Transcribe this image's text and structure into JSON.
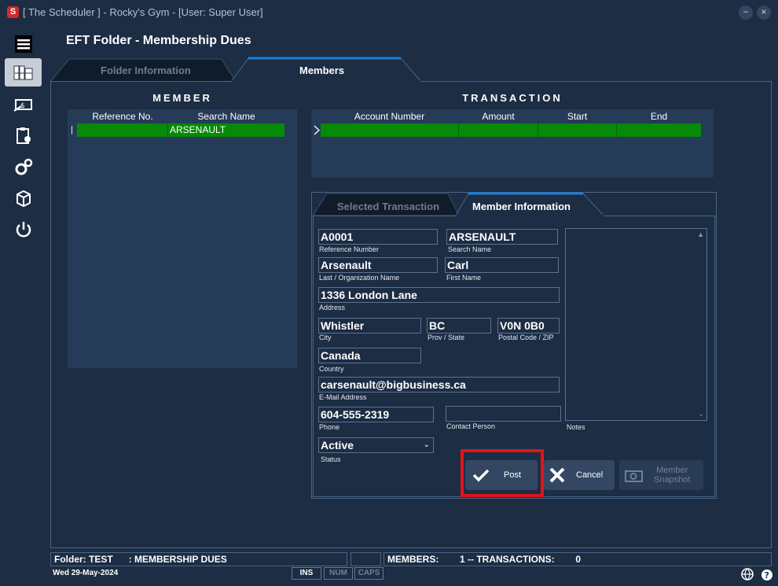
{
  "window": {
    "title": "[ The Scheduler ] - Rocky's Gym - [User: Super User]",
    "icon_letter": "S"
  },
  "page": {
    "title": "EFT Folder - Membership Dues"
  },
  "tabs": {
    "folder_info": "Folder Information",
    "members": "Members"
  },
  "member_section": {
    "heading": "MEMBER",
    "columns": [
      "Reference No.",
      "Search Name"
    ],
    "rows": [
      {
        "ref": "",
        "name": "ARSENAULT"
      }
    ]
  },
  "transaction_section": {
    "heading": "TRANSACTION",
    "columns": [
      "Account Number",
      "Amount",
      "Start",
      "End"
    ]
  },
  "inner_tabs": {
    "selected_transaction": "Selected Transaction",
    "member_information": "Member Information"
  },
  "member_info": {
    "reference_number": {
      "value": "A0001",
      "label": "Reference Number"
    },
    "search_name": {
      "value": "ARSENAULT",
      "label": "Search Name"
    },
    "last_name": {
      "value": "Arsenault",
      "label": "Last / Organization Name"
    },
    "first_name": {
      "value": "Carl",
      "label": "First Name"
    },
    "address": {
      "value": "1336 London Lane",
      "label": "Address"
    },
    "city": {
      "value": "Whistler",
      "label": "City"
    },
    "prov": {
      "value": "BC",
      "label": "Prov / State"
    },
    "postal": {
      "value": "V0N 0B0",
      "label": "Postal Code / ZIP"
    },
    "country": {
      "value": "Canada",
      "label": "Country"
    },
    "email": {
      "value": "carsenault@bigbusiness.ca",
      "label": "E-Mail Address"
    },
    "phone": {
      "value": "604-555-2319",
      "label": "Phone"
    },
    "contact": {
      "value": "",
      "label": "Contact Person"
    },
    "notes_label": "Notes",
    "status": {
      "value": "Active",
      "label": "Status"
    }
  },
  "buttons": {
    "post": "Post",
    "cancel": "Cancel",
    "snapshot_line1": "Member",
    "snapshot_line2": "Snapshot"
  },
  "status_bar": {
    "folder": "Folder: TEST      : MEMBERSHIP DUES",
    "members": "MEMBERS:        1 -- TRANSACTIONS:        0",
    "date": "Wed  29-May-2024",
    "keys": [
      "INS",
      "NUM",
      "CAPS"
    ]
  },
  "colors": {
    "background": "#1c2d44",
    "row_selected": "#078a07",
    "tab_accent": "#1e7fd6",
    "highlight": "#e0141b"
  }
}
